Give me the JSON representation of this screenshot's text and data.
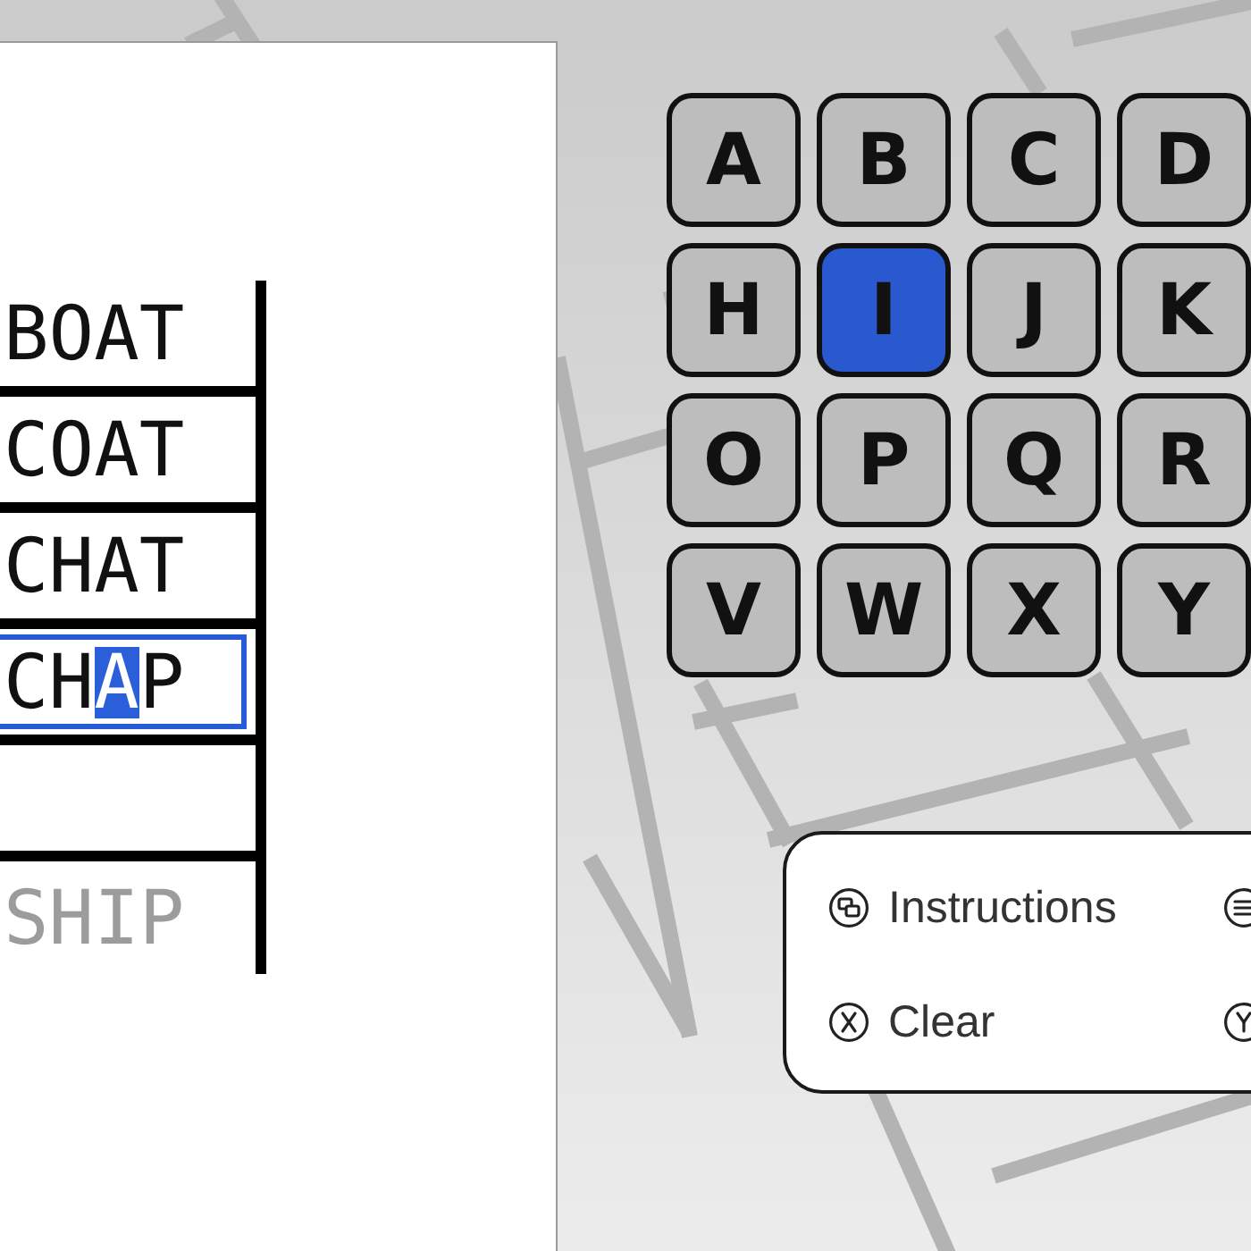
{
  "ladder": {
    "rows": [
      {
        "kind": "word",
        "text": "BOAT"
      },
      {
        "kind": "word",
        "text": "COAT"
      },
      {
        "kind": "word",
        "text": "CHAT"
      },
      {
        "kind": "input",
        "letters": [
          {
            "char": "C",
            "selected": false
          },
          {
            "char": "H",
            "selected": false
          },
          {
            "char": "A",
            "selected": true
          },
          {
            "char": "P",
            "selected": false
          }
        ]
      },
      {
        "kind": "blank"
      },
      {
        "kind": "goal",
        "text": "SHIP"
      }
    ]
  },
  "keyboard": {
    "keys": [
      {
        "label": "A",
        "selected": false
      },
      {
        "label": "B",
        "selected": false
      },
      {
        "label": "C",
        "selected": false
      },
      {
        "label": "D",
        "selected": false
      },
      {
        "label": "H",
        "selected": false
      },
      {
        "label": "I",
        "selected": true
      },
      {
        "label": "J",
        "selected": false
      },
      {
        "label": "K",
        "selected": false
      },
      {
        "label": "O",
        "selected": false
      },
      {
        "label": "P",
        "selected": false
      },
      {
        "label": "Q",
        "selected": false
      },
      {
        "label": "R",
        "selected": false
      },
      {
        "label": "V",
        "selected": false
      },
      {
        "label": "W",
        "selected": false
      },
      {
        "label": "X",
        "selected": false
      },
      {
        "label": "Y",
        "selected": false
      }
    ]
  },
  "controls": [
    {
      "kind": "view",
      "label": "Instructions"
    },
    {
      "kind": "menu"
    },
    {
      "kind": "x",
      "label": "Clear"
    },
    {
      "kind": "y"
    }
  ]
}
